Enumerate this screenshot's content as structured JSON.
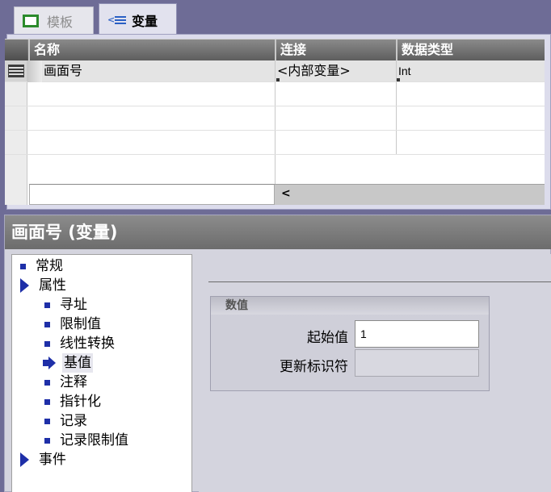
{
  "tabs": [
    {
      "label": "模板",
      "icon": "template-icon",
      "active": false
    },
    {
      "label": "变量",
      "icon": "variable-icon",
      "active": true
    }
  ],
  "grid": {
    "columns": [
      "名称",
      "连接",
      "数据类型"
    ],
    "rows": [
      {
        "name": "画面号",
        "connection": "<内部变量>",
        "type": "Int"
      }
    ]
  },
  "properties": {
    "title": "画面号 (变量)",
    "tree": [
      {
        "label": "常规",
        "kind": "bullet",
        "level": 0
      },
      {
        "label": "属性",
        "kind": "expand",
        "level": 0
      },
      {
        "label": "寻址",
        "kind": "bullet",
        "level": 1
      },
      {
        "label": "限制值",
        "kind": "bullet",
        "level": 1
      },
      {
        "label": "线性转换",
        "kind": "bullet",
        "level": 1
      },
      {
        "label": "基值",
        "kind": "selected",
        "level": 1
      },
      {
        "label": "注释",
        "kind": "bullet",
        "level": 1
      },
      {
        "label": "指针化",
        "kind": "bullet",
        "level": 1
      },
      {
        "label": "记录",
        "kind": "bullet",
        "level": 1
      },
      {
        "label": "记录限制值",
        "kind": "bullet",
        "level": 1
      },
      {
        "label": "事件",
        "kind": "expand",
        "level": 0
      }
    ],
    "group": {
      "title": "数值",
      "start_value_label": "起始值",
      "start_value": "1",
      "update_id_label": "更新标识符",
      "update_id": ""
    }
  },
  "colors": {
    "accent": "#1e2fa8",
    "header": "#6c6c6c"
  }
}
